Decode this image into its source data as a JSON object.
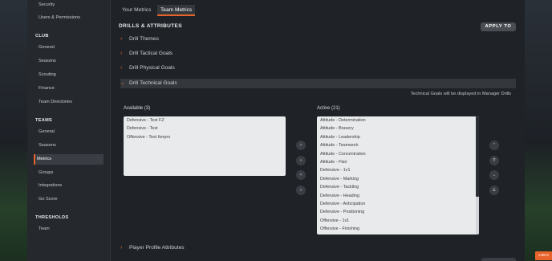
{
  "sidebar": {
    "top_items": [
      {
        "label": "Security"
      },
      {
        "label": "Users & Permissions"
      }
    ],
    "club": {
      "heading": "CLUB",
      "items": [
        {
          "label": "General"
        },
        {
          "label": "Seasons"
        },
        {
          "label": "Scouting"
        },
        {
          "label": "Finance"
        },
        {
          "label": "Team Directories"
        }
      ]
    },
    "teams": {
      "heading": "TEAMS",
      "items": [
        {
          "label": "General"
        },
        {
          "label": "Seasons"
        },
        {
          "label": "Metrics",
          "active": true
        },
        {
          "label": "Groups"
        },
        {
          "label": "Integrations"
        },
        {
          "label": "Go Score"
        }
      ]
    },
    "thresholds": {
      "heading": "THRESHOLDS",
      "items": [
        {
          "label": "Team"
        }
      ]
    }
  },
  "tabs": [
    {
      "label": "Your Metrics",
      "active": false
    },
    {
      "label": "Team Metrics",
      "active": true
    }
  ],
  "main": {
    "section_title": "DRILLS & ATTRIBUTES",
    "apply_label": "APPLY TO",
    "accordions": [
      {
        "label": "Drill Themes",
        "open": false
      },
      {
        "label": "Drill Tactical Goals",
        "open": false
      },
      {
        "label": "Drill Physical Goals",
        "open": false
      },
      {
        "label": "Drill Technical Goals",
        "open": true
      }
    ],
    "info_note": "Technical Goals will be displayed in Manager Drills",
    "available_label": "Available (3)",
    "active_label": "Active (21)",
    "available": [
      "Defensive - Test FZ",
      "Defensive - Test",
      "Offensive - Test Iterpro"
    ],
    "active": [
      "Attitude - Determination",
      "Attitude - Bravery",
      "Attitude - Leadership",
      "Attitude - Teamwork",
      "Attitude - Concentration",
      "Attitude - Flair",
      "Defensive - 1v1",
      "Defensive - Marking",
      "Defensive - Tackling",
      "Defensive - Heading",
      "Defensive - Anticipation",
      "Defensive - Positioning",
      "Offensive - 1v1",
      "Offensive - Finishing"
    ],
    "transfer_buttons": [
      ">",
      "»",
      "<",
      "«"
    ],
    "order_buttons": [
      "⌃",
      "⇈",
      "⌄",
      "⇊"
    ],
    "bottom_accordion": "Player Profile Attributes"
  },
  "version": "v.89.0",
  "colors": {
    "accent": "#e8632b",
    "sidebar_bg": "#25282c",
    "main_bg": "#1f2226",
    "listbox_bg": "#e9eaec"
  }
}
